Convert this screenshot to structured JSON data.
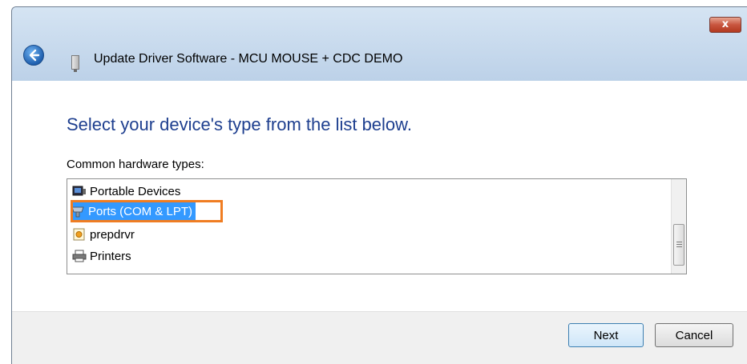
{
  "window": {
    "title": "Update Driver Software - MCU MOUSE + CDC DEMO",
    "close_glyph": "x",
    "back_icon": "back-arrow-icon"
  },
  "main": {
    "heading": "Select your device's type from the list below.",
    "list_label": "Common hardware types:",
    "items": [
      {
        "label": "Portable Devices",
        "icon": "portable-device-icon",
        "selected": false
      },
      {
        "label": "Ports (COM & LPT)",
        "icon": "port-icon",
        "selected": true
      },
      {
        "label": "prepdrvr",
        "icon": "driver-icon",
        "selected": false
      },
      {
        "label": "Printers",
        "icon": "printer-icon",
        "selected": false
      }
    ]
  },
  "footer": {
    "next_label": "Next",
    "cancel_label": "Cancel"
  },
  "colors": {
    "heading": "#1e3f8f",
    "selection": "#3399ff",
    "highlight_border": "#f07d22"
  }
}
